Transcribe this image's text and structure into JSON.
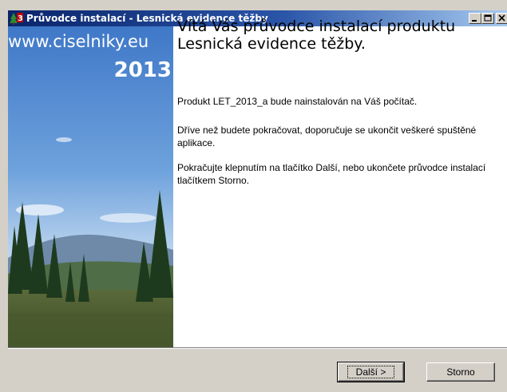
{
  "window": {
    "title": "Průvodce instalací - Lesnická evidence těžby",
    "icon": "app-tree-icon",
    "controls": [
      "minimize-icon",
      "maximize-icon",
      "close-icon"
    ]
  },
  "sidebar": {
    "url": "www.ciselniky.eu",
    "year": "2013"
  },
  "content": {
    "heading": "Vítá Vás průvodce instalací produktu Lesnická evidence těžby.",
    "paragraph1": "Produkt LET_2013_a bude nainstalován na Váš počítač.",
    "paragraph2": "Dříve než budete pokračovat, doporučuje se ukončit veškeré spuštěné aplikace.",
    "paragraph3": "Pokračujte klepnutím na tlačítko Další, nebo ukončete průvodce instalací tlačítkem Storno."
  },
  "buttons": {
    "next": "Další >",
    "cancel": "Storno"
  },
  "colors": {
    "titlebar_start": "#0a246a",
    "titlebar_end": "#a6caf0",
    "face": "#d4d0c8"
  }
}
